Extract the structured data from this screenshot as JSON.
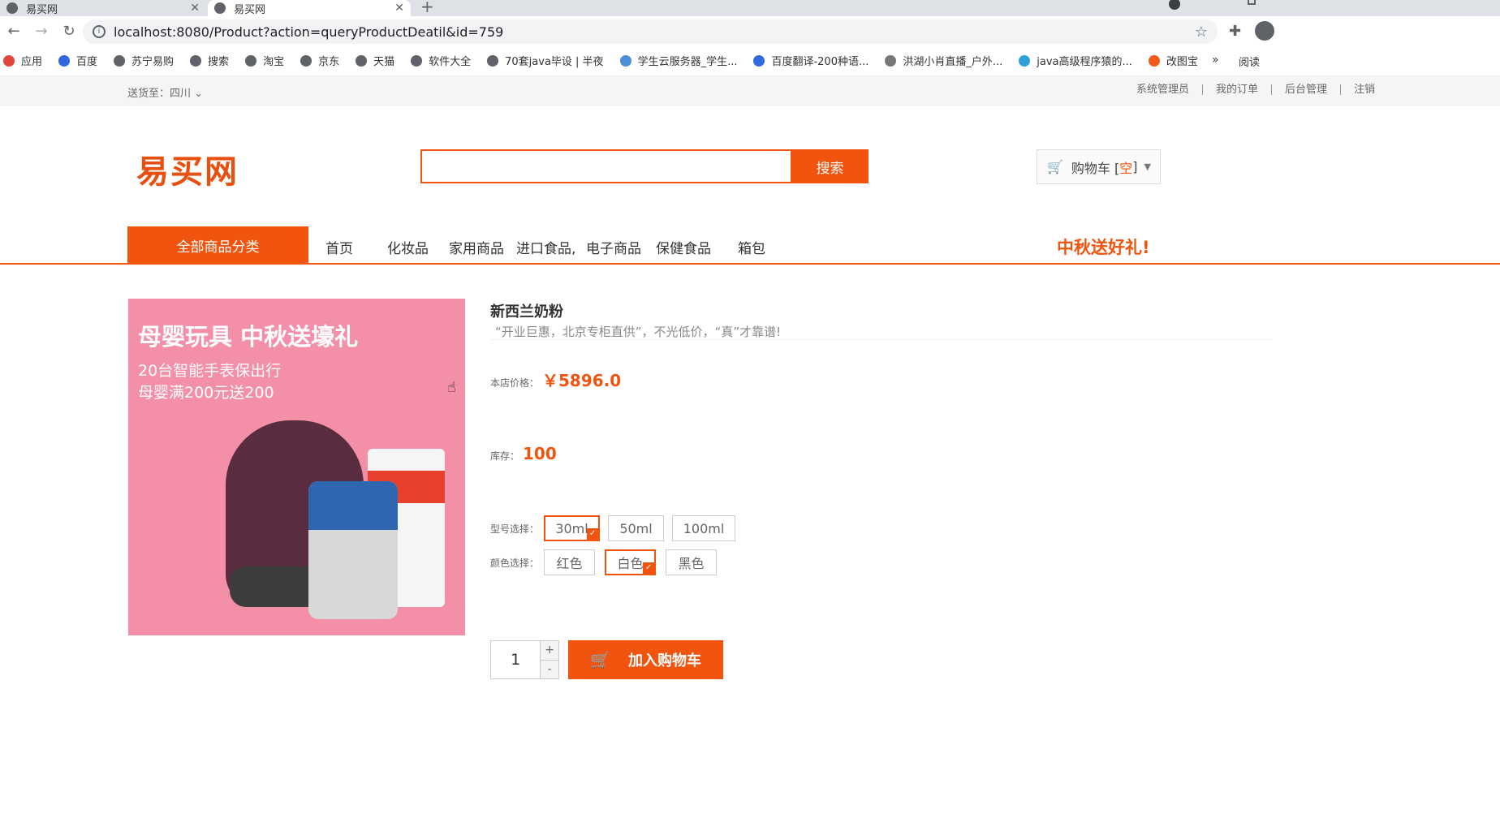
{
  "browser": {
    "tabs": [
      {
        "label": "易买网"
      },
      {
        "label": "易买网"
      }
    ],
    "url": "localhost:8080/Product?action=queryProductDeatil&id=759",
    "bookmarks": [
      {
        "label": "应用",
        "color": "#e0463c"
      },
      {
        "label": "百度",
        "color": "#3168e0"
      },
      {
        "label": "苏宁易购",
        "color": "#5f6368"
      },
      {
        "label": "搜索",
        "color": "#5f6368"
      },
      {
        "label": "淘宝",
        "color": "#5f6368"
      },
      {
        "label": "京东",
        "color": "#5f6368"
      },
      {
        "label": "天猫",
        "color": "#5f6368"
      },
      {
        "label": "软件大全",
        "color": "#5f6368"
      },
      {
        "label": "70套java毕设 | 半夜",
        "color": "#5f6368"
      },
      {
        "label": "学生云服务器_学生...",
        "color": "#4a90d9"
      },
      {
        "label": "百度翻译-200种语...",
        "color": "#2f6be0"
      },
      {
        "label": "洪湖小肖直播_户外...",
        "color": "#777777"
      },
      {
        "label": "java高级程序猿的...",
        "color": "#2fa0d9"
      },
      {
        "label": "改图宝",
        "color": "#f05a1a"
      }
    ],
    "more": "»",
    "reading_list": "阅读"
  },
  "topbar": {
    "ship_label": "送货至：四川",
    "links": [
      "系统管理员",
      "我的订单",
      "后台管理",
      "注销"
    ]
  },
  "header": {
    "logo": "易买网",
    "search_value": "",
    "search_button": "搜索",
    "cart_label": "购物车 [",
    "cart_empty": "空",
    "cart_close": "]"
  },
  "nav": {
    "all_categories": "全部商品分类",
    "links": [
      "首页",
      "化妆品",
      "家用商品",
      "进口食品,",
      "电子商品",
      "保健食品",
      "箱包"
    ],
    "promo": "中秋送好礼!"
  },
  "product": {
    "image_title": "母婴玩具 中秋送壕礼",
    "image_line1": "20台智能手表保出行",
    "image_line2": "母婴满200元送200",
    "name": "新西兰奶粉",
    "slogan": "“开业巨惠，北京专柜直供”，不光低价，“真”才靠谱!",
    "price_label": "本店价格：",
    "price": "￥5896.0",
    "stock_label": "库存：",
    "stock": "100",
    "model_label": "型号选择：",
    "models": [
      "30ml",
      "50ml",
      "100ml"
    ],
    "color_label": "颜色选择：",
    "colors": [
      "红色",
      "白色",
      "黑色"
    ],
    "quantity": "1",
    "qty_plus": "+",
    "qty_minus": "-",
    "add_to_cart": "加入购物车"
  }
}
